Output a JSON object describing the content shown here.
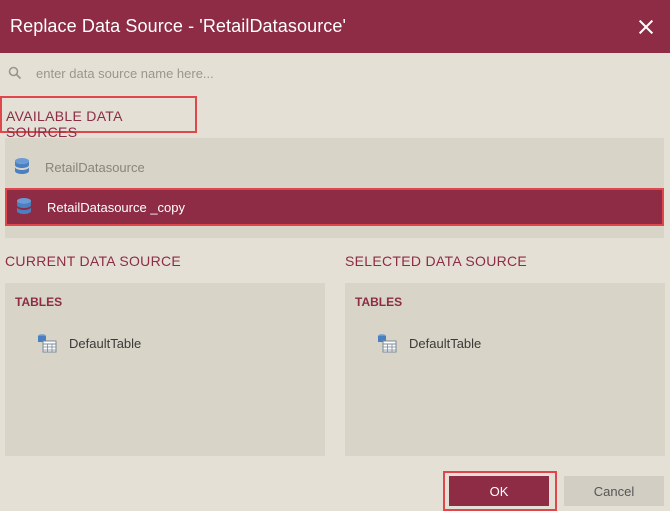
{
  "dialog": {
    "title": "Replace Data Source - 'RetailDatasource'",
    "close_icon": "close-icon"
  },
  "search": {
    "placeholder": "enter data source name here...",
    "value": ""
  },
  "available": {
    "heading": "AVAILABLE DATA SOURCES",
    "items": [
      {
        "label": "RetailDatasource",
        "selected": false
      },
      {
        "label": "RetailDatasource _copy",
        "selected": true
      }
    ]
  },
  "current": {
    "heading": "CURRENT DATA SOURCE",
    "tables_label": "TABLES",
    "tables": [
      "DefaultTable"
    ]
  },
  "selected": {
    "heading": "SELECTED DATA SOURCE",
    "tables_label": "TABLES",
    "tables": [
      "DefaultTable"
    ]
  },
  "buttons": {
    "ok": "OK",
    "cancel": "Cancel"
  },
  "colors": {
    "accent": "#8d2c44",
    "highlight_border": "#e0474d",
    "background": "#e4e0d6",
    "panel": "#d8d4c8",
    "db_icon": "#4a7fc1"
  }
}
